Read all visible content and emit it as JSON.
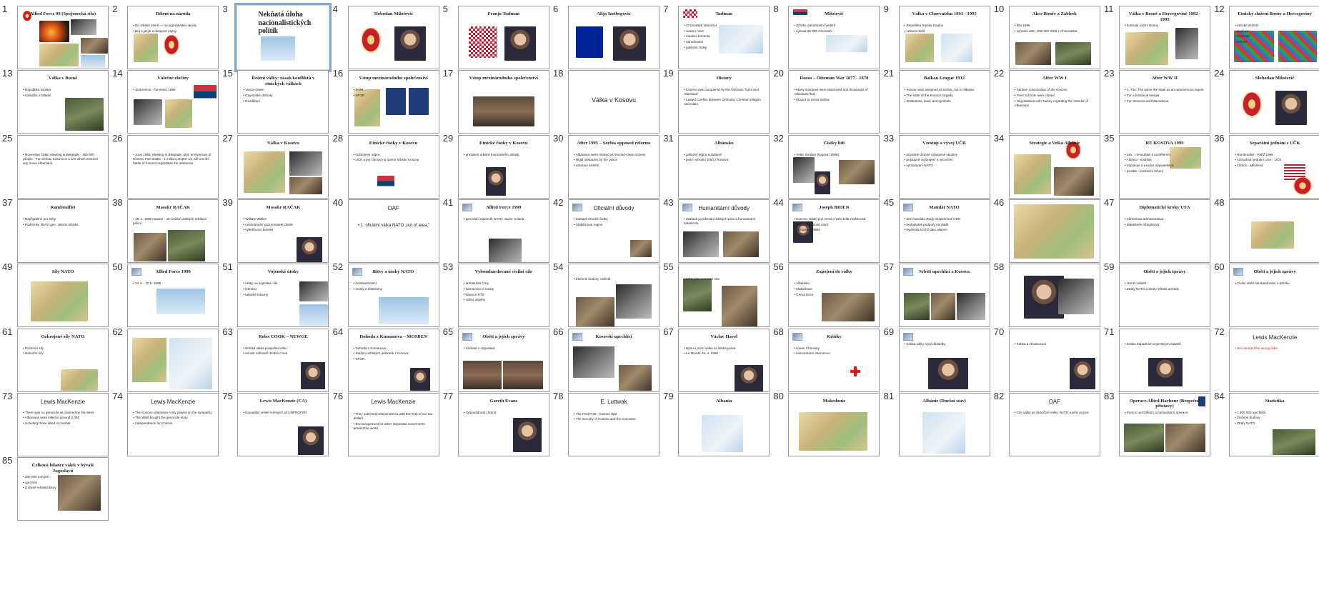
{
  "window": {
    "view": "slide-sorter"
  },
  "selected_slide": 3,
  "slides": [
    {
      "n": "1",
      "title": "Allied Force 99 (Spojenecká síla)",
      "bullets": []
    },
    {
      "n": "2",
      "title": "Dělení na národa",
      "bullets": [
        "Na srbské země — na jugoslávské národy",
        "Boj o jazyk a okrajové zájmy"
      ]
    },
    {
      "n": "3",
      "title": "Nekňatá úloha nacionalistických politik",
      "bullets": []
    },
    {
      "n": "4",
      "title": "Slobodan Milošević",
      "bullets": []
    },
    {
      "n": "5",
      "title": "Franjo Tuđman",
      "bullets": []
    },
    {
      "n": "6",
      "title": "Alija Izetbegović",
      "bullets": []
    },
    {
      "n": "7",
      "title": "Tuđman",
      "bullets": [
        "Chorvatské stranictví",
        "vedení nove",
        "masivní kontrola",
        "národnostní",
        "politické ztráty"
      ]
    },
    {
      "n": "8",
      "title": "Milošević",
      "bullets": [
        "Srbsko národnostní vedení",
        "vyhnali 60.000 Chorvatů"
      ]
    },
    {
      "n": "9",
      "title": "Válka v Chorvatsku 1991 - 1995",
      "bullets": [
        "Republika Srpska Krajina",
        "celkem obětí"
      ]
    },
    {
      "n": "10",
      "title": "Akce Bouře a Záblesk",
      "bullets": [
        "léto 1995",
        "vyhnáni 150 - 200 000 Srbů z Chorvatska"
      ]
    },
    {
      "n": "11",
      "title": "Válka v Bosně a Hercegovině 1992 - 1995",
      "bullets": [
        "kontrola území Bosny"
      ]
    },
    {
      "n": "12",
      "title": "Etnický složení Bosny a Hercegoviny",
      "bullets": [
        "etnické složení",
        "Bosňáci",
        "Chorvati",
        "Srbové"
      ]
    },
    {
      "n": "13",
      "title": "Válka v Bosně",
      "bullets": [
        "Republika Srpska",
        "Karadžić a Mladić"
      ]
    },
    {
      "n": "14",
      "title": "Válečné zločiny",
      "bullets": [
        "Srebrenica - červenec 1995"
      ]
    },
    {
      "n": "15",
      "title": "Řešení války: zásah konfliktů v etnických válkách",
      "bullets": [
        "Vance-Owen",
        "Daytonské dohody",
        "Rozdělení"
      ]
    },
    {
      "n": "16",
      "title": "Vstup mezinárodního společenství",
      "bullets": [
        "IFOR",
        "SFOR"
      ]
    },
    {
      "n": "17",
      "title": "Vstup mezinárodního společenství",
      "bullets": []
    },
    {
      "n": "18",
      "title": "Válka v Kosovu",
      "bullets": []
    },
    {
      "n": "19",
      "title": "History",
      "bullets": [
        "Kosovo was conquered by the Ottoman Turks and Islamised",
        "Lasted Conflict between Orthodox Christian religion and Islam"
      ]
    },
    {
      "n": "20",
      "title": "Russo – Ottoman War 1877 - 1878",
      "bullets": [
        "Many mosques were destroyed and thousands of Albanians fled",
        "Moved to Great Serbia"
      ]
    },
    {
      "n": "21",
      "title": "Balkan League 1912",
      "bullets": [
        "Kosovo was assigned to Serbia, not to Albania",
        "The state of the Kosovo tragedy",
        "Institutions, laws, and symbols"
      ]
    },
    {
      "n": "22",
      "title": "After WW I",
      "bullets": [
        "Serbian colonization of the Kosovo",
        "Their schools were closed",
        "Negotiations with Turkey regarding the transfer of Albanians"
      ]
    },
    {
      "n": "23",
      "title": "After WW II",
      "bullets": [
        "A. Tito: The same the state as an autonomous region",
        "For a historical merger",
        "For Slovenia and Macedonia"
      ]
    },
    {
      "n": "24",
      "title": "Slobodan Milošević",
      "bullets": []
    },
    {
      "n": "25",
      "title": "",
      "bullets": [
        "November 1988: Meeting in Belgrade - 350 000 people - For Serbia, Kosovo is a lure which ensures any move Albanians"
      ]
    },
    {
      "n": "26",
      "title": "",
      "bullets": [
        "June 1989: Meeting in Belgrade, 600. anniversary of Kosovo Pole Battle - 1 million people: we will win the battle of Kosovo regardless the obstacles"
      ]
    },
    {
      "n": "27",
      "title": "Válka v Kosovu",
      "bullets": []
    },
    {
      "n": "28",
      "title": "Etnické čistky v Kosovu",
      "bullets": [
        "Ozbrojený odpor",
        "UČK a její činnost na území Srbsko Kosovu"
      ]
    },
    {
      "n": "29",
      "title": "Etnické čistky v Kosovu",
      "bullets": [
        "prezident srbské Kosovského oblasti"
      ]
    },
    {
      "n": "30",
      "title": "After 1995 – Serbia opposed reforms",
      "bullets": [
        "Albanians were treated as second-class citizens",
        "Rigid obstacles by the police",
        "arbitrary arrests"
      ]
    },
    {
      "n": "31",
      "title": "Albánsko",
      "bullets": [
        "politický odpor a zabíjení",
        "jejich vyhnání Srbů z Kosova"
      ]
    },
    {
      "n": "32",
      "title": "Čistky lidí",
      "bullets": [
        "Vetel: Ibrahim Rugova (1998)"
      ]
    },
    {
      "n": "33",
      "title": "Vzestup a vývoj UČK",
      "bullets": [
        "původně drobné ozbrojené skupiny",
        "postupně vyzbrojení a vycvičení",
        "vybudovaní NATO"
      ]
    },
    {
      "n": "34",
      "title": "Strategie a Velká Albánie",
      "bullets": []
    },
    {
      "n": "35",
      "title": "RE KOSOVA 1999",
      "bullets": [
        "Srb. - nesouhlas s rozdělením",
        "Albánci - souhlas",
        "nepokoje a exodus obyvatelstva",
        "prosba - konkrétní řešení"
      ]
    },
    {
      "n": "36",
      "title": "Separátní jednání s UČK",
      "bullets": [
        "Rambouillet - Paříž 1999",
        "rozhodnutí jednání USA - UČK",
        "Clinton - Milošević"
      ]
    },
    {
      "n": "37",
      "title": "Rambouillet",
      "bullets": [
        "Nepřijatelné pro Srby",
        "Podmínky NATO gen. Jelena Srbska"
      ]
    },
    {
      "n": "38",
      "title": "Masakr RAČAK",
      "bullets": [
        "15. 1. 1999 masakr - 45 civilistů zabitých srbskou policií"
      ]
    },
    {
      "n": "39",
      "title": "Masakr RAČAK",
      "bullets": [
        "William Walker",
        "mezinárodní pozorovatelé OBSE",
        "vyšetřovací komise"
      ]
    },
    {
      "n": "40",
      "title": "OAF",
      "bullets": [
        "1. oficiální válka NATO „out of area.\""
      ]
    },
    {
      "n": "41",
      "title": "Allied Force 1999",
      "bullets": [
        "generální tajemník NATO: Javier Solana"
      ]
    },
    {
      "n": "42",
      "title": "Oficiální důvody",
      "bullets": [
        "Zastavit etnické čistky",
        "Stabilizovat region"
      ]
    },
    {
      "n": "43",
      "title": "Humanitární důvody",
      "bullets": [
        "Zastavit porušování lidských práv a humanitární katastrofu"
      ]
    },
    {
      "n": "44",
      "title": "Joseph BIDEN",
      "bullets": [
        "Kosovo: Nikdo jiný nemá z toho tolik zkušeností",
        "Zastavit nevinné úmrtí",
        "Ochrana civilistů"
      ]
    },
    {
      "n": "45",
      "title": "Mandát NATO",
      "bullets": [
        "bez mandátu Rady bezpečnosti OSN",
        "nedostatek podpory na vládě",
        "legitimita NATO jako aliance"
      ]
    },
    {
      "n": "46",
      "title": "",
      "bullets": []
    },
    {
      "n": "47",
      "title": "Diplomatické kroky USA",
      "bullets": [
        "Clintonova administrativa",
        "Madeleine Albrightová"
      ]
    },
    {
      "n": "48",
      "title": "",
      "bullets": []
    },
    {
      "n": "49",
      "title": "Síly NATO",
      "bullets": []
    },
    {
      "n": "50",
      "title": "Allied Force 1999",
      "bullets": [
        "24.3. - 10.6. 1999"
      ]
    },
    {
      "n": "51",
      "title": "Vojenské útoky",
      "bullets": [
        "útoky na vojenské cíle",
        "letectvo",
        "taktické letouny"
      ]
    },
    {
      "n": "52",
      "title": "Bitvy a útoky NATO",
      "bullets": [
        "bombardování",
        "mosty a elektrárny"
      ]
    },
    {
      "n": "53",
      "title": "Vybombardované civilní cíle",
      "bullets": [
        "ambasáda Číny",
        "nemocnice a mosty",
        "televize RTS",
        "civilní objekty"
      ]
    },
    {
      "n": "54",
      "title": "",
      "bullets": [
        "Zničené budovy civilistů"
      ]
    },
    {
      "n": "55",
      "title": "",
      "bullets": [
        "UČK jako pozemní síla"
      ]
    },
    {
      "n": "56",
      "title": "Zapojení do války",
      "bullets": [
        "Albánsko",
        "Makedonie",
        "Černá Hora"
      ]
    },
    {
      "n": "57",
      "title": "Srbští uprchlíci z Kosova",
      "bullets": []
    },
    {
      "n": "58",
      "title": "",
      "bullets": []
    },
    {
      "n": "59",
      "title": "Oběti a jejich zprávy",
      "bullets": [
        "Úmrtí civilistů",
        "Ztráty NATO a ztráty srbské armády"
      ]
    },
    {
      "n": "60",
      "title": "Oběti a jejich zprávy",
      "bullets": [
        "Civilní oběti bombardování v Srbsku"
      ]
    },
    {
      "n": "61",
      "title": "Ozbrojené síly NATO",
      "bullets": [
        "Pozemní síly",
        "Námořní síly"
      ]
    },
    {
      "n": "62",
      "title": "",
      "bullets": []
    },
    {
      "n": "63",
      "title": "Roles COOK – NEWGE",
      "bullets": [
        "Britská vláda podpořila válku",
        "ministr zahraničí Robin Cook"
      ]
    },
    {
      "n": "64",
      "title": "Dohoda z Kumanova – MOSBEN",
      "bullets": [
        "Dohoda z Kumanova",
        "Stažení srbských jednotek z Kosova",
        "KFOR"
      ]
    },
    {
      "n": "65",
      "title": "Oběti a jejich zprávy",
      "bullets": [
        "Civilisté v Jugoslávii"
      ]
    },
    {
      "n": "66",
      "title": "Kosovští uprchlíci",
      "bullets": []
    },
    {
      "n": "67",
      "title": "Václav Havel",
      "bullets": [
        "Byla to první válka za lidská práva",
        "Le Monde 29. 4. 1999"
      ]
    },
    {
      "n": "68",
      "title": "Kritiky",
      "bullets": [
        "Noam Chomsky",
        "Humanitární intervence"
      ]
    },
    {
      "n": "69",
      "title": "",
      "bullets": [
        "Kritika války a její důsledky"
      ]
    },
    {
      "n": "70",
      "title": "",
      "bullets": [
        "Kritika a zhodnocení"
      ]
    },
    {
      "n": "71",
      "title": "",
      "bullets": [
        "Kritika Západních vojenských zásahů"
      ]
    },
    {
      "n": "72",
      "title": "Lewis MacKenzie",
      "bullets": [
        "We bombed the wrong side!"
      ]
    },
    {
      "n": "73",
      "title": "Lewis MacKenzie",
      "bullets": [
        "There was no genocide as claimed by the West",
        "Albanians were killed in around 2,000",
        "including those killed in combat"
      ]
    },
    {
      "n": "74",
      "title": "Lewis MacKenzie",
      "bullets": [
        "The Kosovo Liberation Army played on the sympathy",
        "The West bought the genocide story",
        "Independence for Kosovo"
      ]
    },
    {
      "n": "75",
      "title": "Lewis MacKenzie (CA)",
      "bullets": [
        "Kanadský velitel mírových sil UNPROFOR"
      ]
    },
    {
      "n": "76",
      "title": "Lewis MacKenzie",
      "bullets": [
        "They achieved independence with the help of our tax dollars",
        "Encouragement for other separatist movements around the world"
      ]
    },
    {
      "n": "77",
      "title": "Gareth Evans",
      "bullets": [
        "Odpovědnost chránit"
      ]
    },
    {
      "n": "78",
      "title": "E. Luttwak",
      "bullets": [
        "The First Post - Kosovo War",
        "The security of Kosovo and the Kosovars"
      ]
    },
    {
      "n": "79",
      "title": "Albania",
      "bullets": []
    },
    {
      "n": "80",
      "title": "Makedonie",
      "bullets": []
    },
    {
      "n": "81",
      "title": "Albánie (Dnešní stav)",
      "bullets": []
    },
    {
      "n": "82",
      "title": "OAF",
      "bullets": [
        "Cíle války po skončení války: NATO a jeho pozice"
      ]
    },
    {
      "n": "83",
      "title": "Operace Allied Harbour (Bezpečné přístavy)",
      "bullets": [
        "Pomoc uprchlíkům a humanitární operace"
      ]
    },
    {
      "n": "84",
      "title": "Statistika",
      "bullets": [
        "1 500 000 uprchlíků",
        "Zničené budovy",
        "Ztráty NATO"
      ]
    },
    {
      "n": "85",
      "title": "Celková bilance válek v bývalé Jugoslávii",
      "bullets": [
        "200 000 mrtvých",
        "uprchlíci",
        "zničené infrastruktury"
      ]
    }
  ]
}
